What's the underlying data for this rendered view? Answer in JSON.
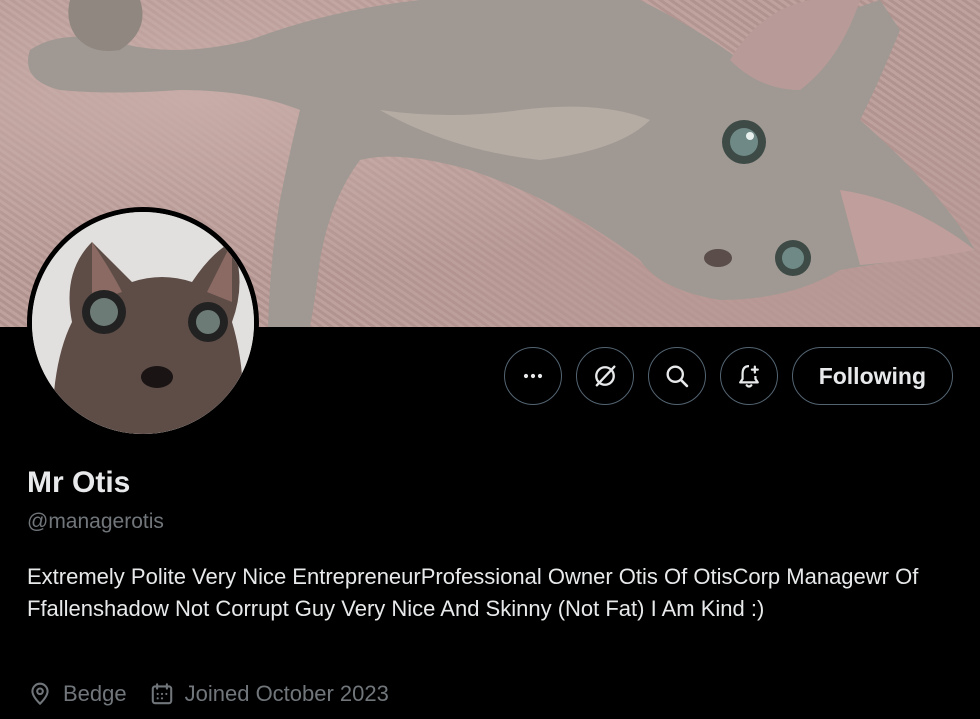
{
  "profile": {
    "display_name": "Mr Otis",
    "handle": "@managerotis",
    "bio": "Extremely Polite Very Nice EntrepreneurProfessional Owner Otis Of OtisCorp Managewr Of Ffallenshadow Not Corrupt Guy Very Nice And Skinny (Not Fat) I Am Kind :)",
    "location": "Bedge",
    "joined": "Joined October 2023"
  },
  "actions": {
    "more_icon": "more-horizontal-icon",
    "grok_icon": "grok-icon",
    "search_icon": "search-icon",
    "notify_icon": "bell-plus-icon",
    "follow_label": "Following"
  },
  "meta_icons": {
    "location": "location-pin-icon",
    "joined": "calendar-icon"
  },
  "colors": {
    "background": "#000000",
    "text_primary": "#e7e9ea",
    "text_secondary": "#71767b",
    "border": "#536471"
  }
}
